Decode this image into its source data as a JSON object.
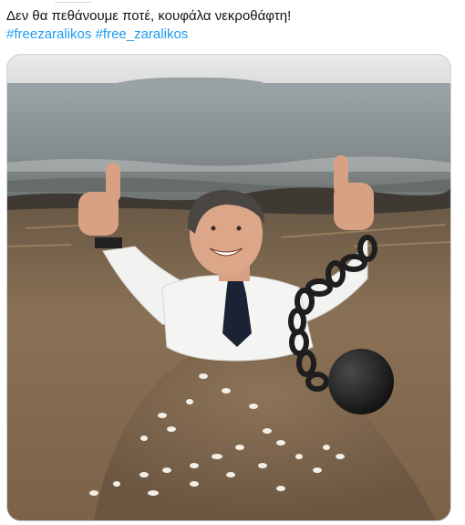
{
  "tweet": {
    "text": "Δεν θα πεθάνουμε ποτέ, κουφάλα νεκροθάφτη!",
    "hashtags": [
      "#freezaralikos",
      "#free_zaralikos"
    ]
  },
  "media": {
    "icons": [
      "thumbs-up-icon",
      "ball-and-chain-icon",
      "seashell-icon"
    ]
  }
}
